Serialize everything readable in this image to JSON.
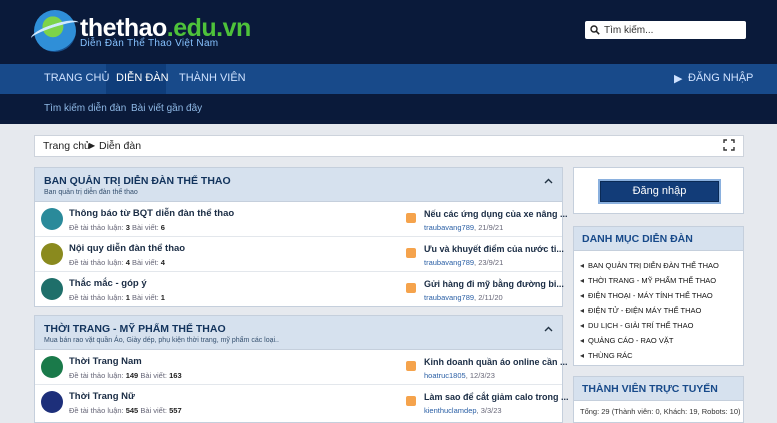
{
  "header": {
    "brand_main": "thethao",
    "brand_tld": ".edu.vn",
    "tagline": "Diễn Đàn Thể Thao Việt Nam",
    "search_placeholder": "Tìm kiếm..."
  },
  "nav": {
    "home": "TRANG CHỦ",
    "forum": "DIỄN ĐÀN",
    "members": "THÀNH VIÊN",
    "login": "ĐĂNG NHẬP"
  },
  "subnav": {
    "search_forum": "Tìm kiếm diễn đàn",
    "recent_posts": "Bài viết gần đây"
  },
  "breadcrumb": {
    "home": "Trang chủ",
    "current": "Diễn đàn"
  },
  "sections": [
    {
      "title": "BAN QUẢN TRỊ DIỄN ĐÀN THỂ THAO",
      "desc": "Ban quản trị diễn đàn thể thao",
      "forums": [
        {
          "name": "Thông báo từ BQT diễn đàn thể thao",
          "threads_label": "Đề tài thảo luận:",
          "threads": "3",
          "posts_label": "Bài viết:",
          "posts": "6",
          "latest": "Nếu các ứng dụng của xe nâng ...",
          "user": "traubavang789",
          "date": "21/9/21",
          "color": "#2a8a9a"
        },
        {
          "name": "Nội quy diễn đàn thể thao",
          "threads_label": "Đề tài thảo luận:",
          "threads": "4",
          "posts_label": "Bài viết:",
          "posts": "4",
          "latest": "Ưu và khuyết điểm của nước ti...",
          "user": "traubavang789",
          "date": "23/9/21",
          "color": "#8a8a1e"
        },
        {
          "name": "Thắc mắc - góp ý",
          "threads_label": "Đề tài thảo luận:",
          "threads": "1",
          "posts_label": "Bài viết:",
          "posts": "1",
          "latest": "Gửi hàng đi mỹ bằng đường bi...",
          "user": "traubavang789",
          "date": "2/11/20",
          "color": "#1f6f6a"
        }
      ]
    },
    {
      "title": "THỜI TRANG - MỸ PHẨM THỂ THAO",
      "desc": "Mua bán rao vặt quần Áo, Giày dép, phụ kiện thời trang, mỹ phẩm các loại..",
      "forums": [
        {
          "name": "Thời Trang Nam",
          "threads_label": "Đề tài thảo luận:",
          "threads": "149",
          "posts_label": "Bài viết:",
          "posts": "163",
          "latest": "Kinh doanh quần áo online cần ...",
          "user": "hoatruc1805",
          "date": "12/3/23",
          "color": "#1a7a4a"
        },
        {
          "name": "Thời Trang Nữ",
          "threads_label": "Đề tài thảo luận:",
          "threads": "545",
          "posts_label": "Bài viết:",
          "posts": "557",
          "latest": "Làm sao để cắt giảm calo trong ...",
          "user": "kienthuclamdep",
          "date": "3/3/23",
          "color": "#1d2f7a"
        }
      ]
    }
  ],
  "sidebar": {
    "login_button": "Đăng nhập",
    "categories_title": "DANH MỤC DIỄN ĐÀN",
    "categories": [
      "BAN QUẢN TRỊ DIỄN ĐÀN THỂ THAO",
      "THỜI TRANG - MỸ PHẨM THỂ THAO",
      "ĐIỆN THOẠI - MÁY TÍNH THỂ THAO",
      "ĐIỆN TỬ - ĐIỆN MÁY THỂ THAO",
      "DU LỊCH - GIẢI TRÍ THỂ THAO",
      "QUẢNG CÁO - RAO VẶT",
      "THÙNG RÁC"
    ],
    "online_title": "THÀNH VIÊN TRỰC TUYẾN",
    "online_stats": "Tổng: 29 (Thành viên: 0, Khách: 19, Robots: 10)"
  }
}
